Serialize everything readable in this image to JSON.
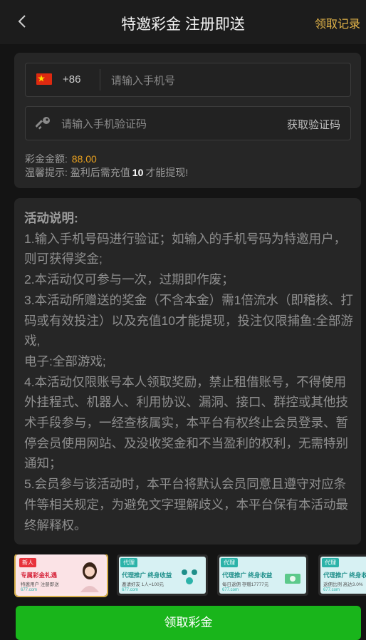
{
  "header": {
    "title": "特邀彩金 注册即送",
    "record_label": "领取记录"
  },
  "form": {
    "country_code": "+86",
    "phone_placeholder": "请输入手机号",
    "code_placeholder": "请输入手机验证码",
    "get_code_label": "获取验证码"
  },
  "bonus": {
    "amount_label": "彩金金额:",
    "amount_value": "88.00",
    "tip_prefix": "温馨提示: 盈利后需充值",
    "tip_value": "10",
    "tip_suffix": "才能提现!"
  },
  "activity": {
    "heading": "活动说明:",
    "lines": [
      "1.输入手机号码进行验证；如输入的手机号码为特邀用户，则可获得奖金;",
      "2.本活动仅可参与一次，过期即作废；",
      "3.本活动所赠送的奖金（不含本金）需1倍流水（即稽核、打码或有效投注）以及充值10才能提现，投注仅限捕鱼:全部游戏,",
      "电子:全部游戏;",
      "4.本活动仅限账号本人领取奖励，禁止租借账号，不得使用外挂程式、机器人、利用协议、漏洞、接口、群控或其他技术手段参与，一经查核属实，本平台有权终止会员登录、暂停会员使用网站、及没收奖金和不当盈利的权利，无需特别通知；",
      "5.会员参与该活动时，本平台将默认会员同意且遵守对应条件等相关规定，为避免文字理解歧义，本平台保有本活动最终解释权。"
    ]
  },
  "banners": [
    {
      "tag": "新人",
      "title": "专属彩金礼遇",
      "sub": "特邀用户 注册即送",
      "foot": "677.com"
    },
    {
      "tag": "代理",
      "title": "代理推广 终身收益",
      "sub": "邀请好友 1人=100元",
      "foot": "677.com"
    },
    {
      "tag": "代理",
      "title": "代理推广 终身收益",
      "sub": "每日返佣 存赠17777元",
      "foot": "677.com"
    },
    {
      "tag": "代理",
      "title": "代理推广 终身收益",
      "sub": "返佣比例 高达3.0%",
      "foot": "677.com"
    }
  ],
  "cta_label": "领取彩金",
  "colors": {
    "accent_gold": "#e8b84a",
    "amount": "#e8a01f",
    "cta_green": "#19b51b"
  }
}
